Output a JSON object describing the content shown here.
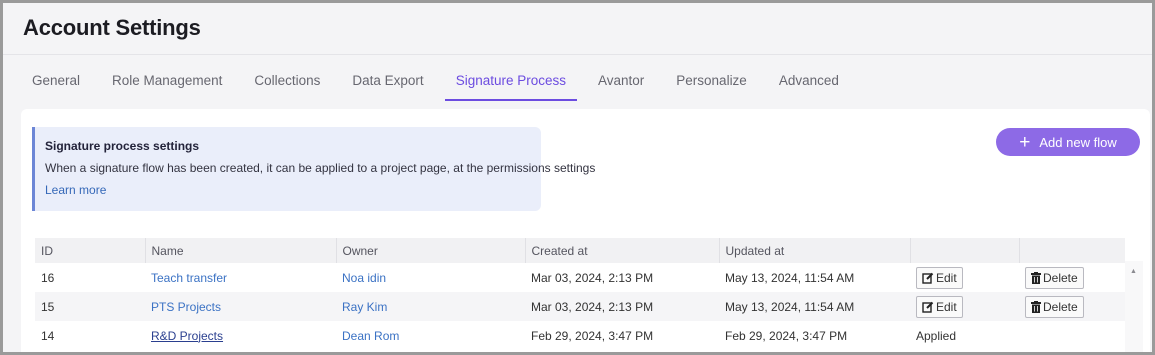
{
  "header": {
    "title": "Account Settings"
  },
  "tabs": [
    {
      "label": "General"
    },
    {
      "label": "Role Management"
    },
    {
      "label": "Collections"
    },
    {
      "label": "Data Export"
    },
    {
      "label": "Signature Process"
    },
    {
      "label": "Avantor"
    },
    {
      "label": "Personalize"
    },
    {
      "label": "Advanced"
    }
  ],
  "active_tab": "Signature Process",
  "info": {
    "title": "Signature process settings",
    "description": "When a signature flow has been created, it can be applied to a project page, at the permissions settings",
    "link": "Learn more"
  },
  "add_button": {
    "label": "Add new flow",
    "icon": "plus-icon"
  },
  "table": {
    "columns": [
      "ID",
      "Name",
      "Owner",
      "Created at",
      "Updated at",
      "",
      ""
    ],
    "rows": [
      {
        "id": "16",
        "name": "Teach transfer",
        "owner": "Noa idin",
        "created": "Mar 03, 2024, 2:13 PM",
        "updated": "May 13, 2024, 11:54 AM",
        "edit": "Edit",
        "delete": "Delete"
      },
      {
        "id": "15",
        "name": "PTS Projects",
        "owner": "Ray Kim",
        "created": "Mar 03, 2024, 2:13 PM",
        "updated": "May 13, 2024, 11:54 AM",
        "edit": "Edit",
        "delete": "Delete"
      },
      {
        "id": "14",
        "name": "R&D Projects",
        "owner": "Dean Rom",
        "created": "Feb 29, 2024, 3:47 PM",
        "updated": "Feb 29, 2024, 3:47 PM",
        "status": "Applied"
      }
    ]
  },
  "colors": {
    "accent": "#6c4ce0",
    "button": "#8d6ae6",
    "link": "#3b72c4",
    "info_bg": "#eaeefa"
  }
}
